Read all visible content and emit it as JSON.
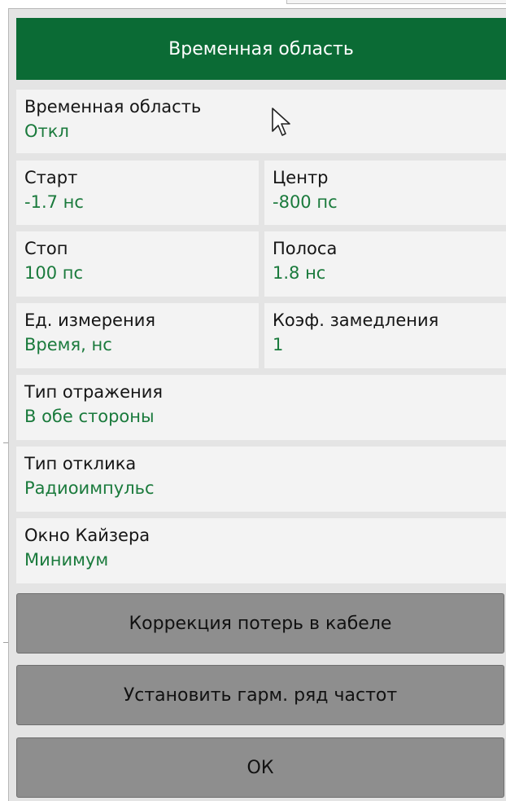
{
  "colors": {
    "header_bg": "#0b6b35",
    "value_text": "#1a7a3c",
    "cell_bg": "#f3f3f3",
    "button_bg": "#8e8e8e",
    "panel_bg": "#e4e4e4"
  },
  "header": {
    "title": "Временная область"
  },
  "fields": {
    "time_domain": {
      "label": "Временная область",
      "value": "Откл"
    },
    "start": {
      "label": "Старт",
      "value": "-1.7 нс"
    },
    "center": {
      "label": "Центр",
      "value": "-800 пс"
    },
    "stop": {
      "label": "Стоп",
      "value": "100 пс"
    },
    "span": {
      "label": "Полоса",
      "value": "1.8 нс"
    },
    "units": {
      "label": "Ед. измерения",
      "value": "Время, нс"
    },
    "velocity_factor": {
      "label": "Коэф. замедления",
      "value": "1"
    },
    "reflection_type": {
      "label": "Тип отражения",
      "value": "В обе стороны"
    },
    "response_type": {
      "label": "Тип отклика",
      "value": "Радиоимпульс"
    },
    "kaiser_window": {
      "label": "Окно Кайзера",
      "value": "Минимум"
    }
  },
  "buttons": {
    "cable_loss": "Коррекция потерь в кабеле",
    "harmonic_grid": "Установить гарм. ряд частот",
    "ok": "ОК"
  },
  "icons": {
    "cursor": "mouse-pointer-icon"
  }
}
